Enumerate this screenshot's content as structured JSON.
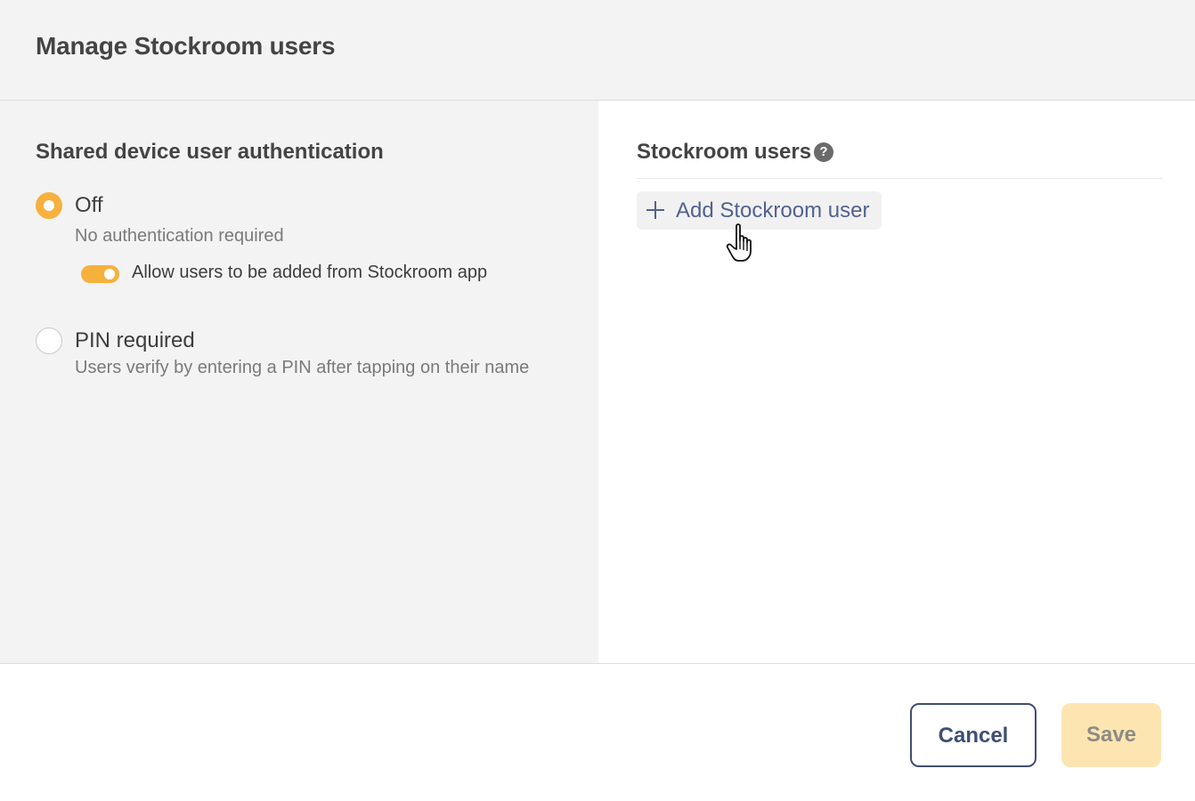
{
  "header": {
    "title": "Manage Stockroom users"
  },
  "auth": {
    "title": "Shared device user authentication",
    "options": [
      {
        "label": "Off",
        "description": "No authentication required",
        "selected": true
      },
      {
        "label": "PIN required",
        "description": "Users verify by entering a PIN after tapping on their name",
        "selected": false
      }
    ],
    "toggle": {
      "label": "Allow users to be added from Stockroom app",
      "on": true
    }
  },
  "users": {
    "title": "Stockroom users",
    "help_icon": "?",
    "add_label": "Add Stockroom user"
  },
  "footer": {
    "cancel_label": "Cancel",
    "save_label": "Save"
  },
  "colors": {
    "accent": "#f6b13d",
    "link": "#52628f",
    "cancel_border": "#3f4e72",
    "save_disabled": "#fde5b2"
  }
}
